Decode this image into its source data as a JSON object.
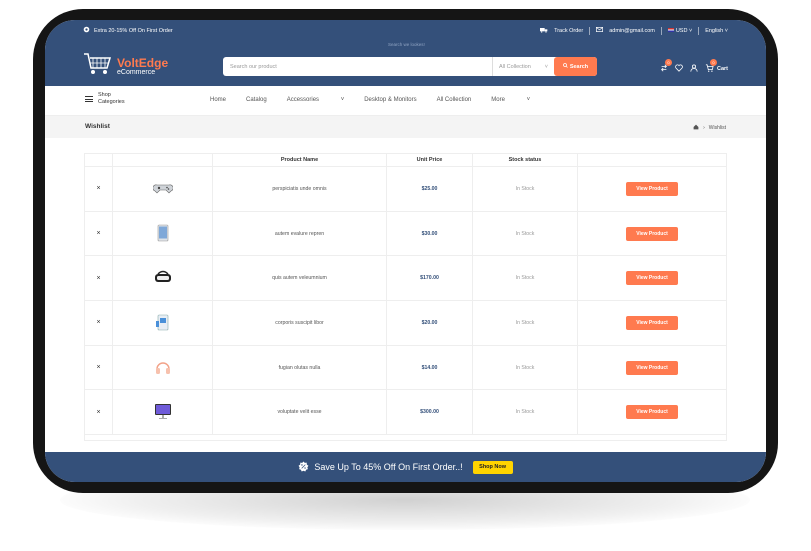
{
  "topbar": {
    "promo": "Extra 20-15% Off On First Order",
    "track_order": "Track Order",
    "email": "admin@gmail.com",
    "currency": "USD",
    "language": "English"
  },
  "header": {
    "brand": "VoltEdge",
    "brand_sub": "eCommerce",
    "search_hint": "Search we lookes!",
    "search_placeholder": "Search our product",
    "collection": "All Collection",
    "search_button": "Search",
    "compare_count": "0",
    "cart_count": "0",
    "cart_label": "Cart"
  },
  "nav": {
    "shop_line1": "Shop",
    "shop_line2": "Categories",
    "items": [
      "Home",
      "Catalog",
      "Accessories",
      "Desktop & Monitors",
      "All Collection",
      "More"
    ]
  },
  "page": {
    "title": "Wishlist",
    "breadcrumb_current": "Wishlist"
  },
  "table": {
    "headers": [
      "",
      "",
      "Product Name",
      "Unit Price",
      "Stock status",
      ""
    ],
    "remove_symbol": "×",
    "button_label": "View Product",
    "rows": [
      {
        "name": "perspiciatis unde omnis",
        "price": "$25.00",
        "stock": "In Stock",
        "icon": "gamepad-icon"
      },
      {
        "name": "autem evalure repren",
        "price": "$30.00",
        "stock": "In Stock",
        "icon": "tablet-icon"
      },
      {
        "name": "quis autem veleumnium",
        "price": "$170.00",
        "stock": "In Stock",
        "icon": "vr-headset-icon"
      },
      {
        "name": "corporis suscipit libor",
        "price": "$20.00",
        "stock": "In Stock",
        "icon": "printer-icon"
      },
      {
        "name": "fugian olutas nulla",
        "price": "$14.00",
        "stock": "In Stock",
        "icon": "headphones-icon"
      },
      {
        "name": "voluptate velit esse",
        "price": "$300.00",
        "stock": "In Stock",
        "icon": "monitor-icon"
      }
    ]
  },
  "footer": {
    "banner_text": "Save Up To 45% Off On First Order..!",
    "shop_now": "Shop Now"
  },
  "colors": {
    "primary": "#34507a",
    "accent": "#ff7a4f",
    "yellow": "#ffd400"
  }
}
